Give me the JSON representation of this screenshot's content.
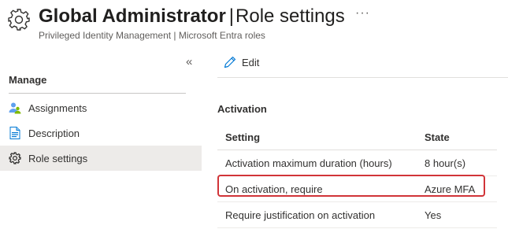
{
  "header": {
    "title_bold": "Global Administrator",
    "title_separator": "|",
    "title_rest": "Role settings",
    "subtitle": "Privileged Identity Management | Microsoft Entra roles",
    "more_label": "···",
    "icon": "gear-icon"
  },
  "sidebar": {
    "collapse_label": "«",
    "section_label": "Manage",
    "items": [
      {
        "label": "Assignments",
        "icon": "users-icon",
        "active": false
      },
      {
        "label": "Description",
        "icon": "document-icon",
        "active": false
      },
      {
        "label": "Role settings",
        "icon": "gear-icon",
        "active": true
      }
    ]
  },
  "toolbar": {
    "edit_label": "Edit",
    "edit_icon": "pencil-icon"
  },
  "activation": {
    "section_title": "Activation",
    "columns": [
      "Setting",
      "State"
    ],
    "rows": [
      {
        "setting": "Activation maximum duration (hours)",
        "state": "8 hour(s)"
      },
      {
        "setting": "On activation, require",
        "state": "Azure MFA",
        "highlighted": true
      },
      {
        "setting": "Require justification on activation",
        "state": "Yes"
      }
    ]
  },
  "colors": {
    "highlight": "#d13438",
    "accent": "#0078d4",
    "active_bg": "#edebe9"
  }
}
